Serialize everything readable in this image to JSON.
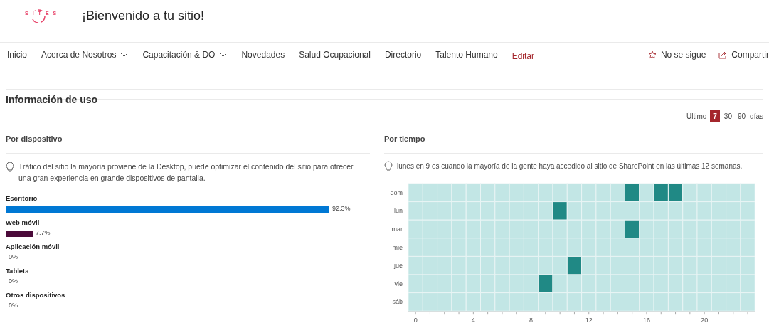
{
  "header": {
    "logo_text": "SITES",
    "title": "¡Bienvenido a tu sitio!"
  },
  "nav": {
    "items": [
      {
        "label": "Inicio",
        "has_menu": false
      },
      {
        "label": "Acerca de Nosotros",
        "has_menu": true
      },
      {
        "label": "Capacitación & DO",
        "has_menu": true
      },
      {
        "label": "Novedades",
        "has_menu": false
      },
      {
        "label": "Salud Ocupacional",
        "has_menu": false
      },
      {
        "label": "Directorio",
        "has_menu": false
      },
      {
        "label": "Talento Humano",
        "has_menu": false
      }
    ],
    "edit_link": "Editar",
    "actions": [
      {
        "kind": "follow",
        "label": "No se sigue"
      },
      {
        "kind": "share",
        "label": "Compartir"
      }
    ]
  },
  "usage": {
    "title": "Información de uso",
    "range_label": "Último",
    "ranges": [
      {
        "label": "7",
        "selected": true
      },
      {
        "label": "30",
        "selected": false
      },
      {
        "label": "90",
        "selected": false
      }
    ],
    "range_unit": "días"
  },
  "by_device": {
    "title": "Por dispositivo",
    "tip": "Tráfico del sitio la mayoría proviene de la Desktop, puede optimizar el contenido del sitio para ofrecer una gran experiencia en grande dispositivos de pantalla.",
    "devices": [
      {
        "name": "Escritorio",
        "reading": "92.3%",
        "color": "#0078d4"
      },
      {
        "name": "Web móvil",
        "reading": "7.7%",
        "color": "#4b0a3a"
      },
      {
        "name": "Aplicación móvil",
        "reading": "0%"
      },
      {
        "name": "Tableta",
        "reading": "0%"
      },
      {
        "name": "Otros dispositivos",
        "reading": "0%"
      }
    ]
  },
  "by_time": {
    "title": "Por tiempo",
    "tip": "lunes en 9 es cuando la mayoría de la gente haya accedido al sitio de SharePoint en las últimas 12 semanas.",
    "heatmap": {
      "xticks": [
        "0",
        "4",
        "8",
        "12",
        "16",
        "20"
      ],
      "rows": [
        {
          "label": "dom",
          "cells": [
            false,
            false,
            false,
            false,
            false,
            false,
            false,
            false,
            false,
            false,
            false,
            false,
            false,
            false,
            false,
            true,
            false,
            true,
            true,
            false,
            false,
            false,
            false,
            false
          ]
        },
        {
          "label": "lun",
          "cells": [
            false,
            false,
            false,
            false,
            false,
            false,
            false,
            false,
            false,
            false,
            true,
            false,
            false,
            false,
            false,
            false,
            false,
            false,
            false,
            false,
            false,
            false,
            false,
            false
          ]
        },
        {
          "label": "mar",
          "cells": [
            false,
            false,
            false,
            false,
            false,
            false,
            false,
            false,
            false,
            false,
            false,
            false,
            false,
            false,
            false,
            true,
            false,
            false,
            false,
            false,
            false,
            false,
            false,
            false
          ]
        },
        {
          "label": "mié",
          "cells": [
            false,
            false,
            false,
            false,
            false,
            false,
            false,
            false,
            false,
            false,
            false,
            false,
            false,
            false,
            false,
            false,
            false,
            false,
            false,
            false,
            false,
            false,
            false,
            false
          ]
        },
        {
          "label": "jue",
          "cells": [
            false,
            false,
            false,
            false,
            false,
            false,
            false,
            false,
            false,
            false,
            false,
            true,
            false,
            false,
            false,
            false,
            false,
            false,
            false,
            false,
            false,
            false,
            false,
            false
          ]
        },
        {
          "label": "vie",
          "cells": [
            false,
            false,
            false,
            false,
            false,
            false,
            false,
            false,
            false,
            true,
            false,
            false,
            false,
            false,
            false,
            false,
            false,
            false,
            false,
            false,
            false,
            false,
            false,
            false
          ]
        },
        {
          "label": "sáb",
          "cells": [
            false,
            false,
            false,
            false,
            false,
            false,
            false,
            false,
            false,
            false,
            false,
            false,
            false,
            false,
            false,
            false,
            false,
            false,
            false,
            false,
            false,
            false,
            false,
            false
          ]
        }
      ]
    }
  }
}
